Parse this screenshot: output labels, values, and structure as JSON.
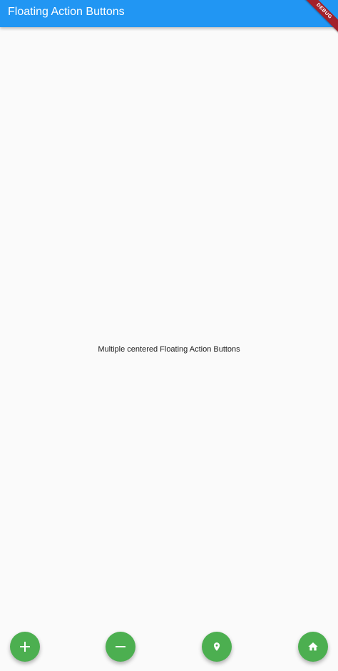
{
  "appbar": {
    "title": "Floating Action Buttons",
    "color": "#2196f3"
  },
  "debug_banner": {
    "label": "DEBUG"
  },
  "body": {
    "message": "Multiple centered Floating Action Buttons"
  },
  "fabs": [
    {
      "icon": "add-icon",
      "color": "#4caf50"
    },
    {
      "icon": "remove-icon",
      "color": "#4caf50"
    },
    {
      "icon": "location-pin-icon",
      "color": "#4caf50"
    },
    {
      "icon": "home-icon",
      "color": "#4caf50"
    }
  ]
}
